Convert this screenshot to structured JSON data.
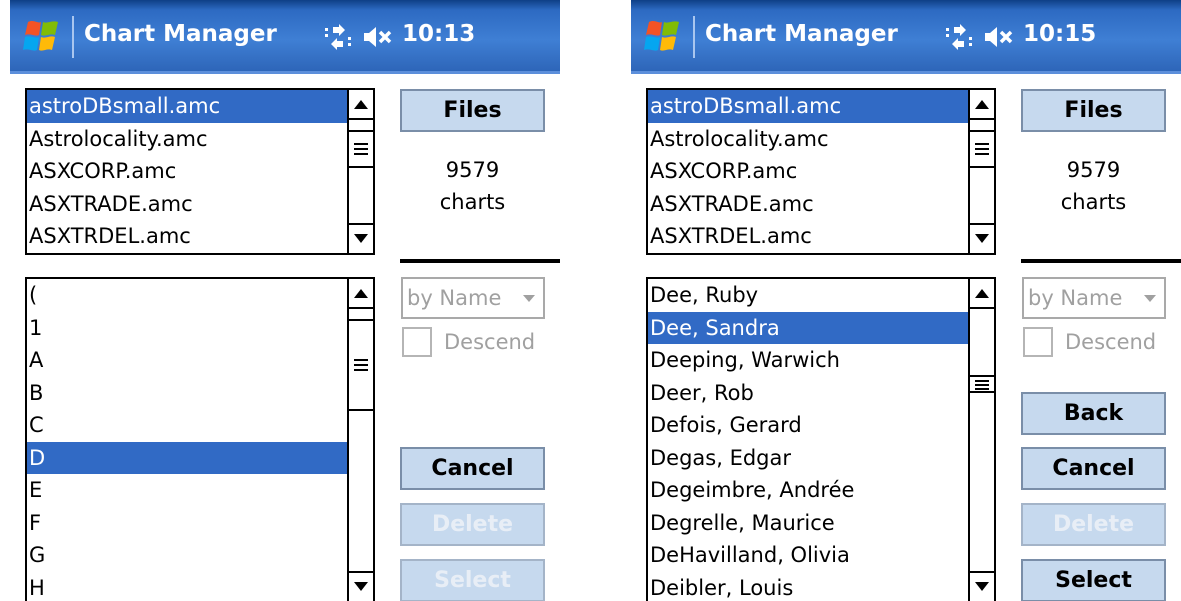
{
  "screens": [
    {
      "title": "Chart Manager",
      "clock": "10:13",
      "files": {
        "items": [
          "astroDBsmall.amc",
          "Astrolocality.amc",
          "ASXCORP.amc",
          "ASXTRADE.amc",
          "ASXTRDEL.amc"
        ],
        "selected_index": 0
      },
      "files_button": "Files",
      "chart_count": "9579",
      "chart_count_label": "charts",
      "sort_dropdown": "by Name",
      "descend_label": "Descend",
      "names": {
        "items": [
          "(",
          "1",
          "A",
          "B",
          "C",
          "D",
          "E",
          "F",
          "G",
          "H"
        ],
        "selected_index": 5
      },
      "buttons": {
        "back": "",
        "cancel": "Cancel",
        "delete": "Delete",
        "select": "Select"
      },
      "button_state": {
        "back_visible": false,
        "delete_enabled": false,
        "select_enabled": false
      }
    },
    {
      "title": "Chart Manager",
      "clock": "10:15",
      "files": {
        "items": [
          "astroDBsmall.amc",
          "Astrolocality.amc",
          "ASXCORP.amc",
          "ASXTRADE.amc",
          "ASXTRDEL.amc"
        ],
        "selected_index": 0
      },
      "files_button": "Files",
      "chart_count": "9579",
      "chart_count_label": "charts",
      "sort_dropdown": "by Name",
      "descend_label": "Descend",
      "names": {
        "items": [
          "Dee, Ruby",
          "Dee, Sandra",
          "Deeping, Warwich",
          "Deer, Rob",
          "Defois, Gerard",
          "Degas, Edgar",
          "Degeimbre, Andrée",
          "Degrelle, Maurice",
          "DeHavilland, Olivia",
          "Deibler, Louis"
        ],
        "selected_index": 1
      },
      "buttons": {
        "back": "Back",
        "cancel": "Cancel",
        "delete": "Delete",
        "select": "Select"
      },
      "button_state": {
        "back_visible": true,
        "delete_enabled": false,
        "select_enabled": true
      }
    }
  ],
  "colors": {
    "titlebar": "#3f7fd4",
    "selection": "#316ac5",
    "button_face": "#c6d9ee",
    "disabled_text": "#a0a0a0"
  },
  "icons": [
    "windows-start-flag-icon",
    "connectivity-icon",
    "volume-muted-icon",
    "scroll-up-arrow-icon",
    "scroll-down-arrow-icon",
    "dropdown-arrow-icon"
  ]
}
